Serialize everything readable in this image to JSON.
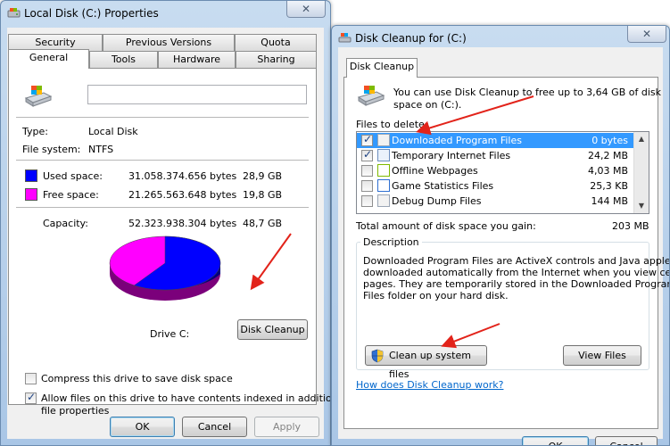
{
  "properties_window": {
    "title": "Local Disk (C:) Properties",
    "tabs_top": [
      "Security",
      "Previous Versions",
      "Quota"
    ],
    "tabs_bottom": [
      "General",
      "Tools",
      "Hardware",
      "Sharing"
    ],
    "drive_name_value": "",
    "type_label": "Type:",
    "type_value": "Local Disk",
    "fs_label": "File system:",
    "fs_value": "NTFS",
    "used_label": "Used space:",
    "used_bytes": "31.058.374.656 bytes",
    "used_gb": "28,9 GB",
    "free_label": "Free space:",
    "free_bytes": "21.265.563.648 bytes",
    "free_gb": "19,8 GB",
    "capacity_label": "Capacity:",
    "capacity_bytes": "52.323.938.304 bytes",
    "capacity_gb": "48,7 GB",
    "drive_label": "Drive C:",
    "disk_cleanup_button": "Disk Cleanup",
    "compress_label": "Compress this drive to save disk space",
    "compress_checked": false,
    "index_label_line1": "Allow files on this drive to have contents indexed in addition to",
    "index_label_line2": "file properties",
    "index_checked": true,
    "ok": "OK",
    "cancel": "Cancel",
    "apply": "Apply",
    "colors": {
      "used": "#0000ff",
      "free": "#ff00ff"
    },
    "used_fraction": 0.594
  },
  "cleanup_window": {
    "title": "Disk Cleanup for  (C:)",
    "tab": "Disk Cleanup",
    "intro_line1": "You can use Disk Cleanup to free up to 3,64 GB of disk",
    "intro_line2": "space on  (C:).",
    "files_to_delete_label": "Files to delete:",
    "items": [
      {
        "name": "Downloaded Program Files",
        "size": "0 bytes",
        "checked": true,
        "selected": true
      },
      {
        "name": "Temporary Internet Files",
        "size": "24,2 MB",
        "checked": true,
        "selected": false
      },
      {
        "name": "Offline Webpages",
        "size": "4,03 MB",
        "checked": false,
        "selected": false
      },
      {
        "name": "Game Statistics Files",
        "size": "25,3 KB",
        "checked": false,
        "selected": false
      },
      {
        "name": "Debug Dump Files",
        "size": "144 MB",
        "checked": false,
        "selected": false
      }
    ],
    "total_label": "Total amount of disk space you gain:",
    "total_value": "203 MB",
    "description_title": "Description",
    "description_lines": [
      "Downloaded Program Files are ActiveX controls and Java applets",
      "downloaded automatically from the Internet when you view certain",
      "pages. They are temporarily stored in the Downloaded Program",
      "Files folder on your hard disk."
    ],
    "clean_system_button": "Clean up system files",
    "view_files_button": "View Files",
    "help_link": "How does Disk Cleanup work?",
    "ok": "OK",
    "cancel": "Cancel"
  }
}
